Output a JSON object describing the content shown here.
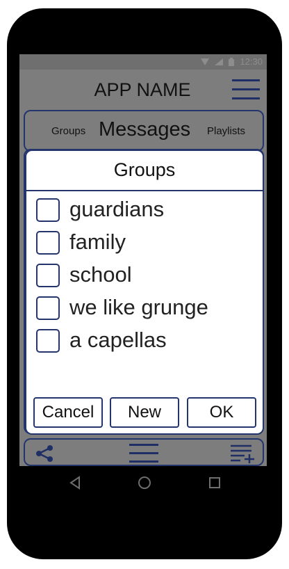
{
  "status_bar": {
    "time": "12:30",
    "wifi_icon": "wifi-icon",
    "signal_icon": "signal-icon",
    "battery_icon": "battery-icon"
  },
  "app_bar": {
    "title": "APP NAME",
    "menu_icon": "hamburger-icon"
  },
  "tabs": {
    "left": "Groups",
    "active": "Messages",
    "right": "Playlists"
  },
  "dialog": {
    "title": "Groups",
    "groups": [
      {
        "label": "guardians",
        "checked": false
      },
      {
        "label": "family",
        "checked": false
      },
      {
        "label": "school",
        "checked": false
      },
      {
        "label": "we like grunge",
        "checked": false
      },
      {
        "label": "a capellas",
        "checked": false
      }
    ],
    "buttons": {
      "cancel": "Cancel",
      "new": "New",
      "ok": "OK"
    }
  },
  "bottom_bar": {
    "icons": [
      "share-icon",
      "menu-icon",
      "playlist-add-icon"
    ]
  },
  "nav_bar": {
    "icons": [
      "back-icon",
      "home-icon",
      "recents-icon"
    ]
  },
  "colors": {
    "accent": "#24356e",
    "screen_overlay": "#7d7d7d",
    "phone_body": "#000000"
  }
}
